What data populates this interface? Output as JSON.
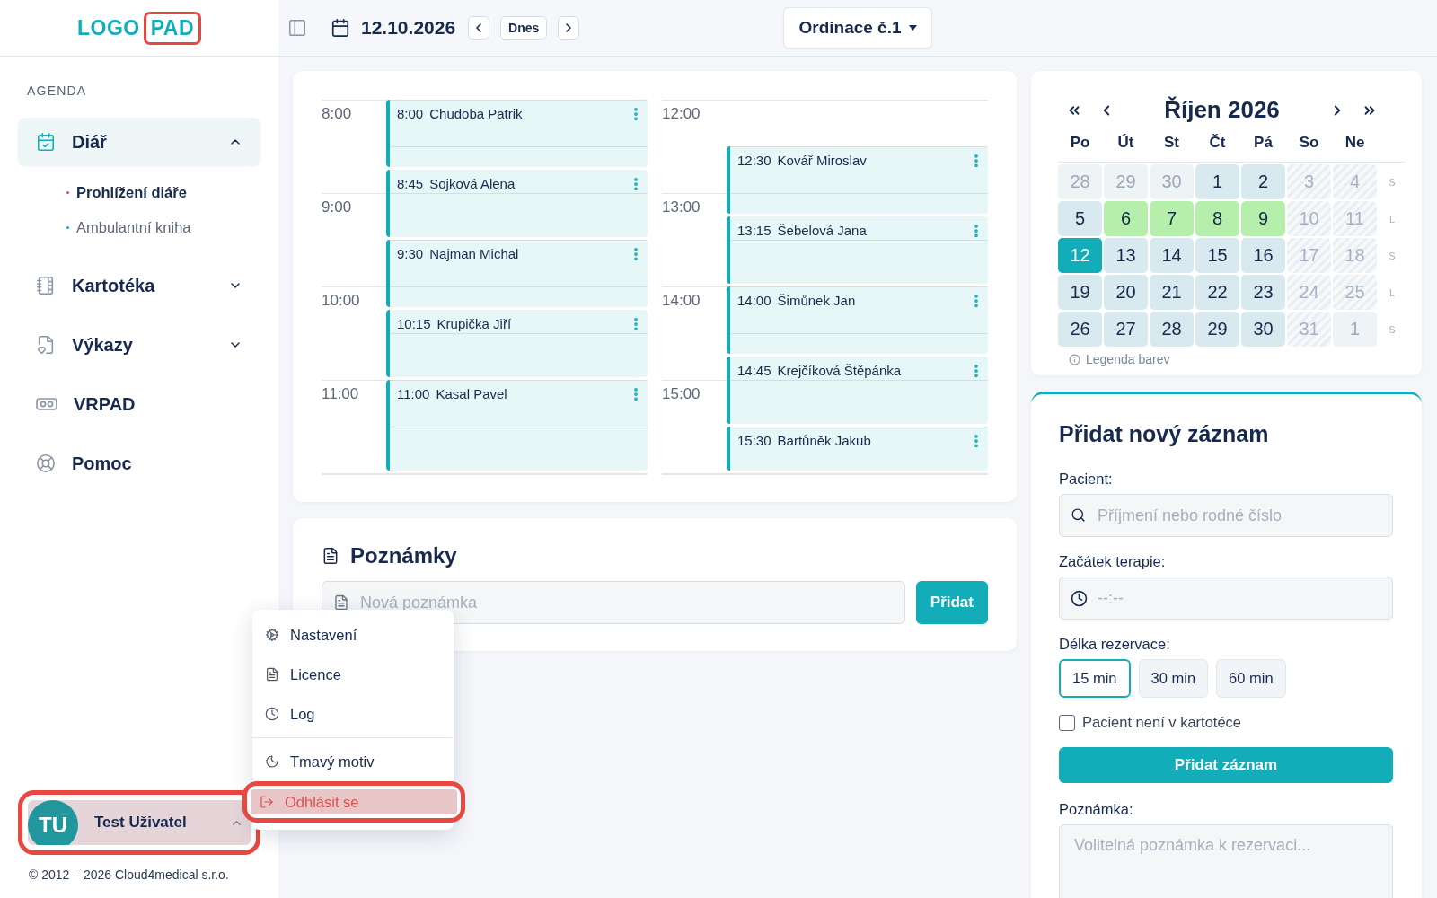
{
  "logo": {
    "part_1": "LOGO",
    "part_2": "PAD"
  },
  "toolbar": {
    "date": "12.10.2026",
    "today": "Dnes",
    "location": "Ordinace č.1"
  },
  "sidebar": {
    "section": "AGENDA",
    "items": [
      {
        "label": "Diář",
        "selected": true,
        "expanded": true,
        "children": [
          {
            "label": "Prohlížení diáře",
            "selected": true
          },
          {
            "label": "Ambulantní kniha",
            "selected": false
          }
        ]
      },
      {
        "label": "Kartotéka",
        "selected": false,
        "expanded": false
      },
      {
        "label": "Výkazy",
        "selected": false,
        "expanded": false
      },
      {
        "label": "VRPAD",
        "selected": false
      },
      {
        "label": "Pomoc",
        "selected": false
      }
    ]
  },
  "user": {
    "initials": "TU",
    "name": "Test Uživatel",
    "menu_open": true,
    "highlighted": true
  },
  "copyright": "© 2012 – 2026 Cloud4medical s.r.o.",
  "user_menu": {
    "groups": [
      {
        "items": [
          {
            "label": "Nastavení",
            "kind": "normal",
            "highlighted": false
          },
          {
            "label": "Licence",
            "kind": "normal",
            "highlighted": false
          },
          {
            "label": "Log",
            "kind": "normal",
            "highlighted": false
          }
        ]
      },
      {
        "items": [
          {
            "label": "Tmavý motiv",
            "kind": "normal",
            "highlighted": false
          },
          {
            "label": "Odhlásit se",
            "kind": "danger",
            "highlighted": true
          }
        ]
      }
    ]
  },
  "schedule": {
    "columns": [
      {
        "hours": [
          "8:00",
          "9:00",
          "10:00",
          "11:00"
        ],
        "appointments": [
          {
            "time": "8:00",
            "name": "Chudoba Patrik"
          },
          {
            "time": "8:45",
            "name": "Sojková Alena"
          },
          {
            "time": "9:30",
            "name": "Najman Michal"
          },
          {
            "time": "10:15",
            "name": "Krupička Jiří"
          },
          {
            "time": "11:00",
            "name": "Kasal Pavel"
          }
        ]
      },
      {
        "hours": [
          "12:00",
          "13:00",
          "14:00",
          "15:00"
        ],
        "appointments": [
          {
            "time": "12:30",
            "name": "Kovář Miroslav"
          },
          {
            "time": "13:15",
            "name": "Šebelová Jana"
          },
          {
            "time": "14:00",
            "name": "Šimůnek Jan"
          },
          {
            "time": "14:45",
            "name": "Krejčíková Štěpánka"
          },
          {
            "time": "15:30",
            "name": "Bartůněk Jakub"
          }
        ]
      }
    ]
  },
  "notes": {
    "title": "Poznámky",
    "placeholder": "Nová poznámka",
    "button": "Přidat"
  },
  "calendar": {
    "title": "Říjen 2026",
    "weekdays": [
      "Po",
      "Út",
      "St",
      "Čt",
      "Pá",
      "So",
      "Ne"
    ],
    "weeks": [
      {
        "parity": "S",
        "days": [
          {
            "day": "28",
            "kind": "outside",
            "selected": false
          },
          {
            "day": "29",
            "kind": "outside",
            "selected": false
          },
          {
            "day": "30",
            "kind": "outside",
            "selected": false
          },
          {
            "day": "1",
            "kind": "workday",
            "selected": false
          },
          {
            "day": "2",
            "kind": "workday",
            "selected": false
          },
          {
            "day": "3",
            "kind": "weekend",
            "selected": false
          },
          {
            "day": "4",
            "kind": "weekend",
            "selected": false
          }
        ]
      },
      {
        "parity": "L",
        "days": [
          {
            "day": "5",
            "kind": "workday",
            "selected": false
          },
          {
            "day": "6",
            "kind": "booked",
            "selected": false
          },
          {
            "day": "7",
            "kind": "booked",
            "selected": false
          },
          {
            "day": "8",
            "kind": "booked",
            "selected": false
          },
          {
            "day": "9",
            "kind": "booked",
            "selected": false
          },
          {
            "day": "10",
            "kind": "weekend",
            "selected": false
          },
          {
            "day": "11",
            "kind": "weekend",
            "selected": false
          }
        ]
      },
      {
        "parity": "S",
        "days": [
          {
            "day": "12",
            "kind": "workday",
            "selected": true
          },
          {
            "day": "13",
            "kind": "workday",
            "selected": false
          },
          {
            "day": "14",
            "kind": "workday",
            "selected": false
          },
          {
            "day": "15",
            "kind": "workday",
            "selected": false
          },
          {
            "day": "16",
            "kind": "workday",
            "selected": false
          },
          {
            "day": "17",
            "kind": "weekend",
            "selected": false
          },
          {
            "day": "18",
            "kind": "weekend",
            "selected": false
          }
        ]
      },
      {
        "parity": "L",
        "days": [
          {
            "day": "19",
            "kind": "workday",
            "selected": false
          },
          {
            "day": "20",
            "kind": "workday",
            "selected": false
          },
          {
            "day": "21",
            "kind": "workday",
            "selected": false
          },
          {
            "day": "22",
            "kind": "workday",
            "selected": false
          },
          {
            "day": "23",
            "kind": "workday",
            "selected": false
          },
          {
            "day": "24",
            "kind": "weekend",
            "selected": false
          },
          {
            "day": "25",
            "kind": "weekend",
            "selected": false
          }
        ]
      },
      {
        "parity": "S",
        "days": [
          {
            "day": "26",
            "kind": "workday",
            "selected": false
          },
          {
            "day": "27",
            "kind": "workday",
            "selected": false
          },
          {
            "day": "28",
            "kind": "workday",
            "selected": false
          },
          {
            "day": "29",
            "kind": "workday",
            "selected": false
          },
          {
            "day": "30",
            "kind": "workday",
            "selected": false
          },
          {
            "day": "31",
            "kind": "weekend",
            "selected": false
          },
          {
            "day": "1",
            "kind": "outside",
            "selected": false
          }
        ]
      }
    ],
    "legend": "Legenda barev"
  },
  "form": {
    "title": "Přidat nový záznam",
    "patient": {
      "label": "Pacient:",
      "placeholder": "Příjmení nebo rodné číslo"
    },
    "start": {
      "label": "Začátek terapie:",
      "placeholder": "--:--"
    },
    "duration": {
      "label": "Délka rezervace:",
      "options": [
        {
          "label": "15 min",
          "selected": true
        },
        {
          "label": "30 min",
          "selected": false
        },
        {
          "label": "60 min",
          "selected": false
        }
      ]
    },
    "not_in_registry": {
      "label": "Pacient není v kartotéce",
      "checked": false
    },
    "submit": "Přidat záznam",
    "note": {
      "label": "Poznámka:",
      "placeholder": "Volitelná poznámka k rezervaci..."
    }
  }
}
